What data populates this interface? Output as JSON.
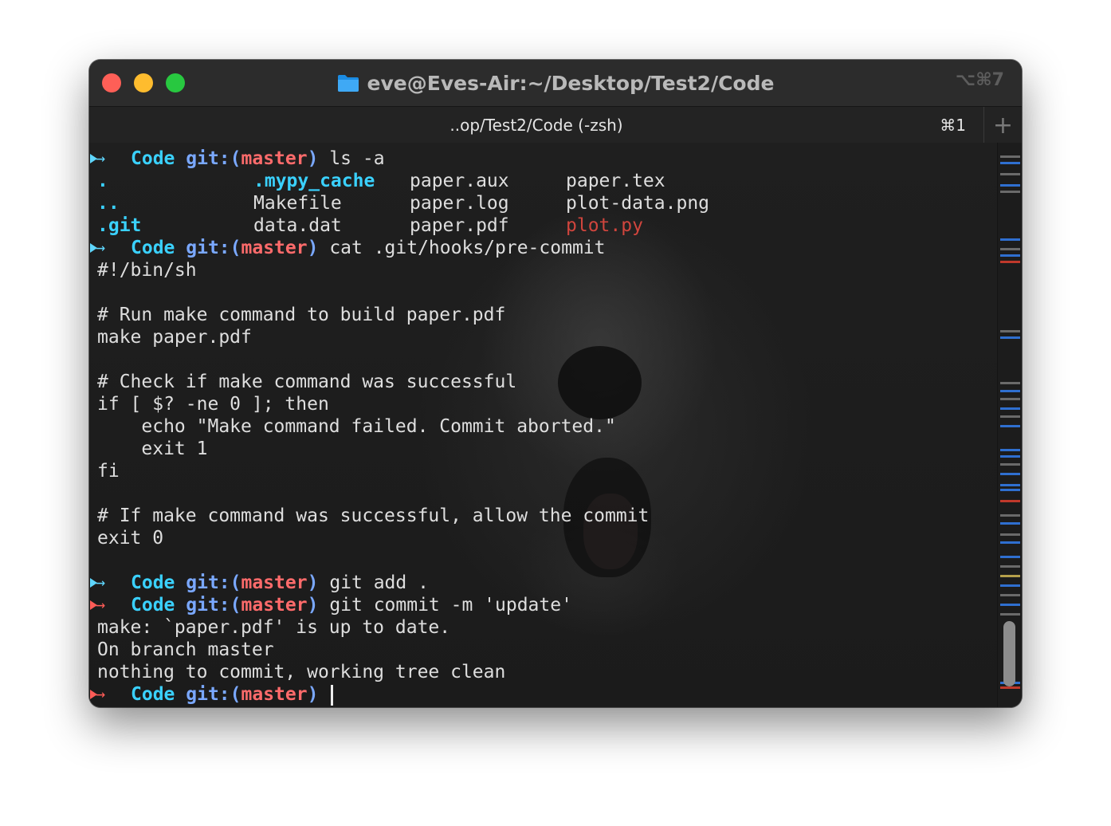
{
  "window": {
    "title": "eve@Eves-Air:~/Desktop/Test2/Code",
    "shortcut": "⌥⌘7",
    "folder_icon": "folder-icon"
  },
  "tab": {
    "label": "..op/Test2/Code (-zsh)",
    "shortcut": "⌘1",
    "new_tab": "+"
  },
  "prompt": {
    "dir": "Code",
    "git": "git:(",
    "branch": "master",
    "close": ")"
  },
  "commands": {
    "ls": "ls -a",
    "cat": "cat .git/hooks/pre-commit",
    "add": "git add .",
    "commit": "git commit -m 'update'"
  },
  "ls_output": {
    "col1": [
      ".",
      "..",
      ".git"
    ],
    "col2": [
      ".mypy_cache",
      "Makefile",
      "data.dat"
    ],
    "col3": [
      "paper.aux",
      "paper.log",
      "paper.pdf"
    ],
    "col4": [
      "paper.tex",
      "plot-data.png",
      "plot.py"
    ]
  },
  "script_lines": [
    "#!/bin/sh",
    "",
    "# Run make command to build paper.pdf",
    "make paper.pdf",
    "",
    "# Check if make command was successful",
    "if [ $? -ne 0 ]; then",
    "    echo \"Make command failed. Commit aborted.\"",
    "    exit 1",
    "fi",
    "",
    "# If make command was successful, allow the commit",
    "exit 0",
    ""
  ],
  "commit_output": [
    "make: `paper.pdf' is up to date.",
    "On branch master",
    "nothing to commit, working tree clean"
  ],
  "colors": {
    "prompt_ok": "#5fd7ff",
    "prompt_err": "#ff5c57",
    "dir": "#3ad1ff",
    "git": "#7aa8ff",
    "branch": "#ff6b6b",
    "executable": "#d0453d"
  }
}
